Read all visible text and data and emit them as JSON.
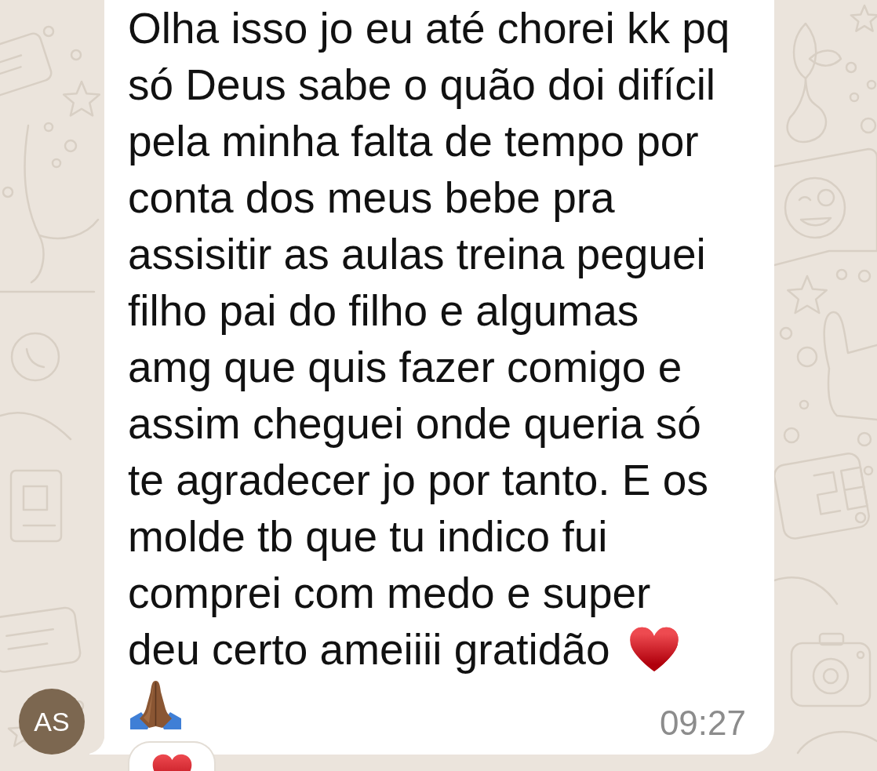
{
  "chat": {
    "sender": {
      "initials": "AS"
    },
    "message": {
      "text": "Olha isso jo eu até chorei kk pq\nsó Deus sabe o quão doi difícil\npela minha falta de tempo por\nconta dos meus bebe pra\nassisitir as aulas treina peguei\nfilho pai do filho e algumas\namg que quis fazer comigo e\nassim cheguei onde queria só\nte agradecer jo por tanto. E os\nmolde tb que tu indico fui\ncomprei com medo e super\ndeu certo ameiiii gratidão",
      "emoji": "❤️",
      "time": "09:27"
    }
  }
}
